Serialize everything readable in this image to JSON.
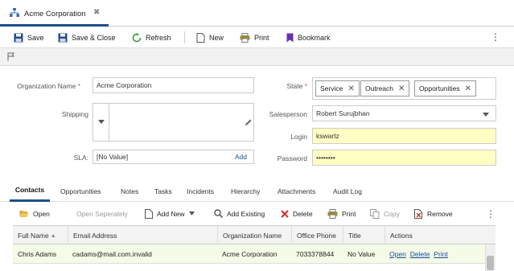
{
  "window": {
    "tab_title": "Acme Corporation",
    "tab_close": "✖"
  },
  "toolbar": {
    "save": "Save",
    "save_close": "Save & Close",
    "refresh": "Refresh",
    "new": "New",
    "print": "Print",
    "bookmark": "Bookmark",
    "more": "⋮"
  },
  "form": {
    "org_name_label": "Organization Name",
    "org_name_value": "Acme Corporation",
    "state_label": "State",
    "state_pills": [
      "Service",
      "Outreach",
      "Opportunities"
    ],
    "shipping_label": "Shipping",
    "salesperson_label": "Salesperson",
    "salesperson_value": "Robert Surujbhan",
    "login_label": "Login",
    "login_value": "kswartz",
    "sla_label": "SLA:",
    "sla_value": "[No Value]",
    "sla_add": "Add",
    "password_label": "Password",
    "password_value": "••••••••",
    "required_mark": "*"
  },
  "tabs": [
    "Contacts",
    "Opportunities",
    "Notes",
    "Tasks",
    "Incidents",
    "Hierarchy",
    "Attachments",
    "Audit Log"
  ],
  "grid_toolbar": {
    "open": "Open",
    "open_separately": "Open Seperately",
    "add_new": "Add New",
    "add_existing": "Add Existing",
    "delete": "Delete",
    "print": "Print",
    "copy": "Copy",
    "remove": "Remove",
    "more": "⋮"
  },
  "table": {
    "columns": [
      "Full Name",
      "Email Address",
      "Organization Name",
      "Office Phone",
      "Title",
      "Actions"
    ],
    "rows": [
      {
        "full_name": "Chris Adams",
        "email": "cadams@mail.com.invalid",
        "org": "Acme Corporation",
        "phone": "7033378844",
        "title": "No Value",
        "actions": [
          "Open",
          "Delete",
          "Print"
        ]
      }
    ]
  },
  "colors": {
    "accent": "#1e4e8c",
    "req": "#d9534f",
    "yellow_field": "#ffffc4",
    "selected_row": "#f4fbe6",
    "link": "#1a4ea1"
  }
}
